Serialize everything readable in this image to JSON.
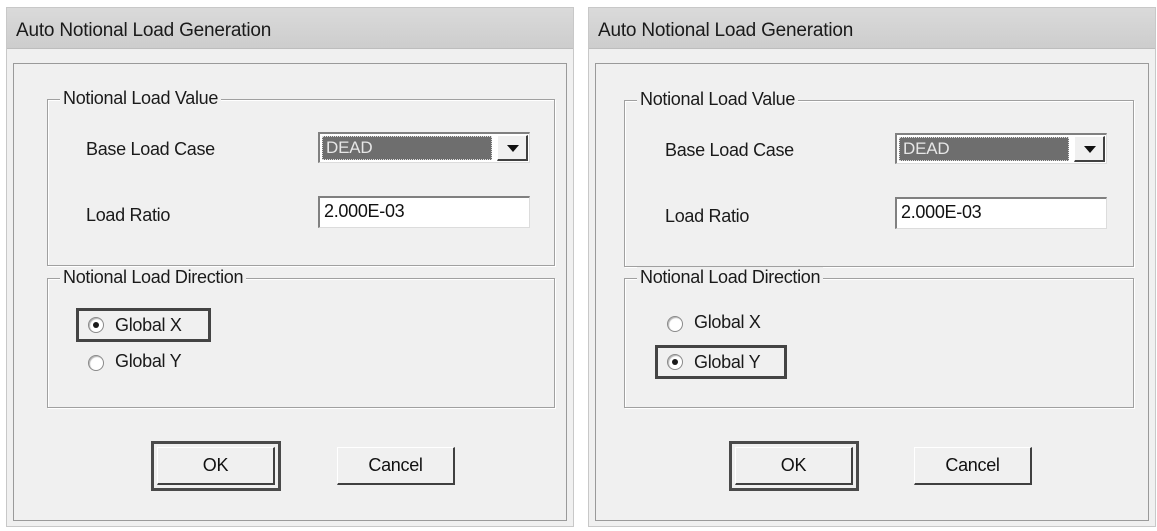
{
  "dialogs": [
    {
      "title": "Auto Notional Load Generation",
      "value_group": {
        "title": "Notional Load Value",
        "base_load_case_label": "Base Load Case",
        "base_load_case_value": "DEAD",
        "load_ratio_label": "Load Ratio",
        "load_ratio_value": "2.000E-03"
      },
      "direction_group": {
        "title": "Notional Load Direction",
        "options": [
          "Global X",
          "Global Y"
        ],
        "selected": "Global X"
      },
      "buttons": {
        "ok": "OK",
        "cancel": "Cancel"
      }
    },
    {
      "title": "Auto Notional Load Generation",
      "value_group": {
        "title": "Notional Load Value",
        "base_load_case_label": "Base Load Case",
        "base_load_case_value": "DEAD",
        "load_ratio_label": "Load Ratio",
        "load_ratio_value": "2.000E-03"
      },
      "direction_group": {
        "title": "Notional Load Direction",
        "options": [
          "Global X",
          "Global Y"
        ],
        "selected": "Global Y"
      },
      "buttons": {
        "ok": "OK",
        "cancel": "Cancel"
      }
    }
  ],
  "icons": {
    "dropdown": "chevron-down-icon",
    "radio_selected": "radio-selected-icon",
    "radio_unselected": "radio-unselected-icon"
  },
  "colors": {
    "dialog_bg": "#f0f0f0",
    "titlebar_bg": "#d4d4d4",
    "combo_selection_bg": "#6e6e6e"
  }
}
